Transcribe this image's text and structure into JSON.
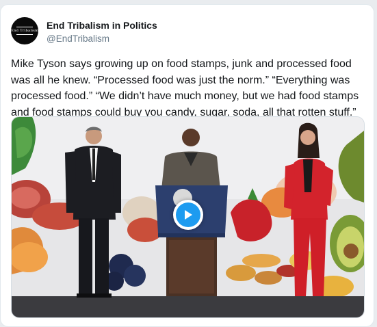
{
  "tweet": {
    "author": {
      "name": "End Tribalism in Politics",
      "handle": "@EndTribalism",
      "avatar_text": "End Tribalism"
    },
    "text": "Mike Tyson says growing up on food stamps, junk and processed food was all he knew. “Processed food was just the norm.” “Everything was processed food.” “We didn’t have much money, but we had food stamps and food stamps could buy you candy, sugar, soda, all that rotten stuff.”",
    "media": {
      "type": "video",
      "play_icon": "play-icon"
    }
  },
  "colors": {
    "play_button": "#1d9bf0",
    "podium": "#2c3f6e",
    "red_suit": "#d3232c"
  }
}
